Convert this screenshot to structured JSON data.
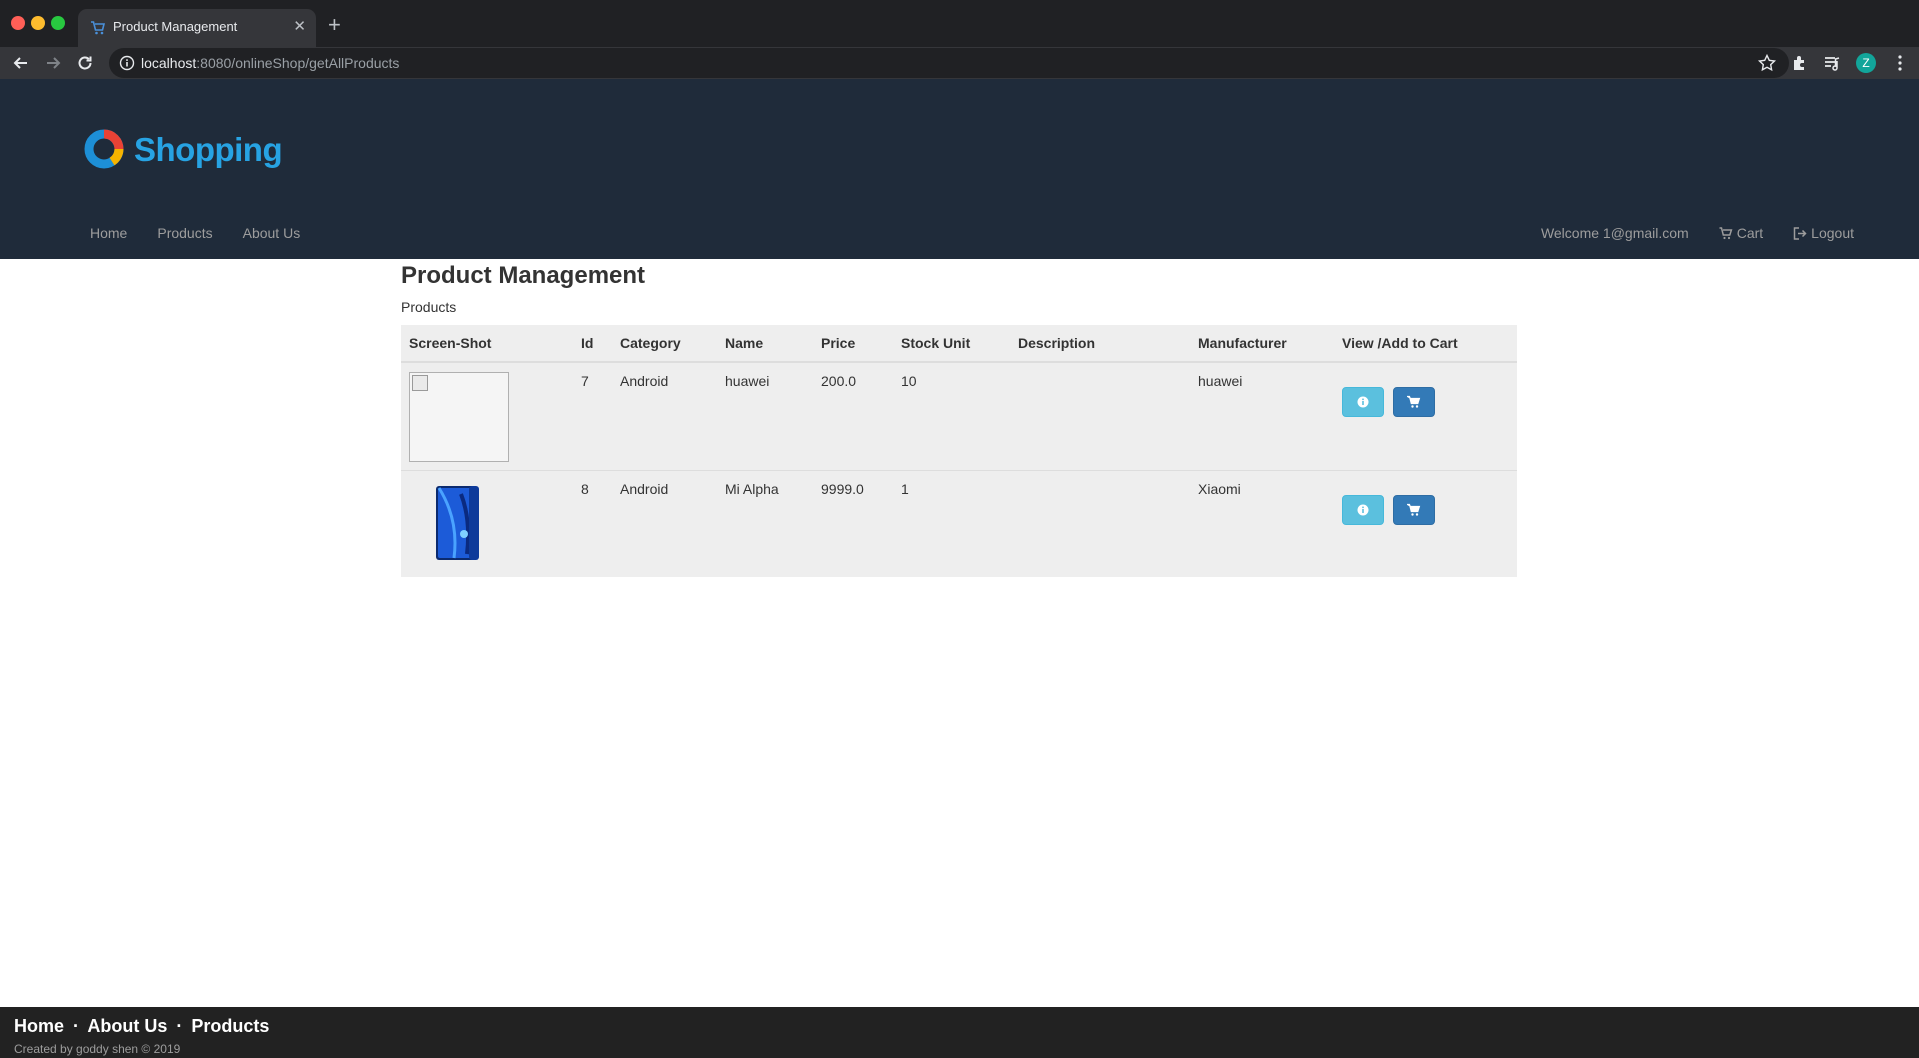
{
  "browser": {
    "tab_title": "Product Management",
    "tab_close": "✕",
    "new_tab": "+",
    "url_host": "localhost",
    "url_path": ":8080/onlineShop/getAllProducts",
    "profile_initial": "Z"
  },
  "header": {
    "logo_text": "Shopping",
    "nav_left": [
      "Home",
      "Products",
      "About Us"
    ],
    "welcome": "Welcome 1@gmail.com",
    "cart": "Cart",
    "logout": "Logout"
  },
  "main": {
    "title": "Product Management",
    "subtitle": "Products",
    "columns": [
      "Screen-Shot",
      "Id",
      "Category",
      "Name",
      "Price",
      "Stock Unit",
      "Description",
      "Manufacturer",
      "View /Add to Cart"
    ],
    "rows": [
      {
        "id": "7",
        "category": "Android",
        "name": "huawei",
        "price": "200.0",
        "stock": "10",
        "description": "",
        "manufacturer": "huawei",
        "image": "broken"
      },
      {
        "id": "8",
        "category": "Android",
        "name": "Mi Alpha",
        "price": "9999.0",
        "stock": "1",
        "description": "",
        "manufacturer": "Xiaomi",
        "image": "phone"
      }
    ]
  },
  "footer": {
    "links": [
      "Home",
      "About Us",
      "Products"
    ],
    "separator": "·",
    "credit": "Created by goddy shen © 2019"
  },
  "colors": {
    "header_bg": "#1f2b3a",
    "logo_blue": "#27a3e3",
    "btn_info": "#5bc0de",
    "btn_primary": "#337ab7",
    "footer_bg": "#222222"
  }
}
